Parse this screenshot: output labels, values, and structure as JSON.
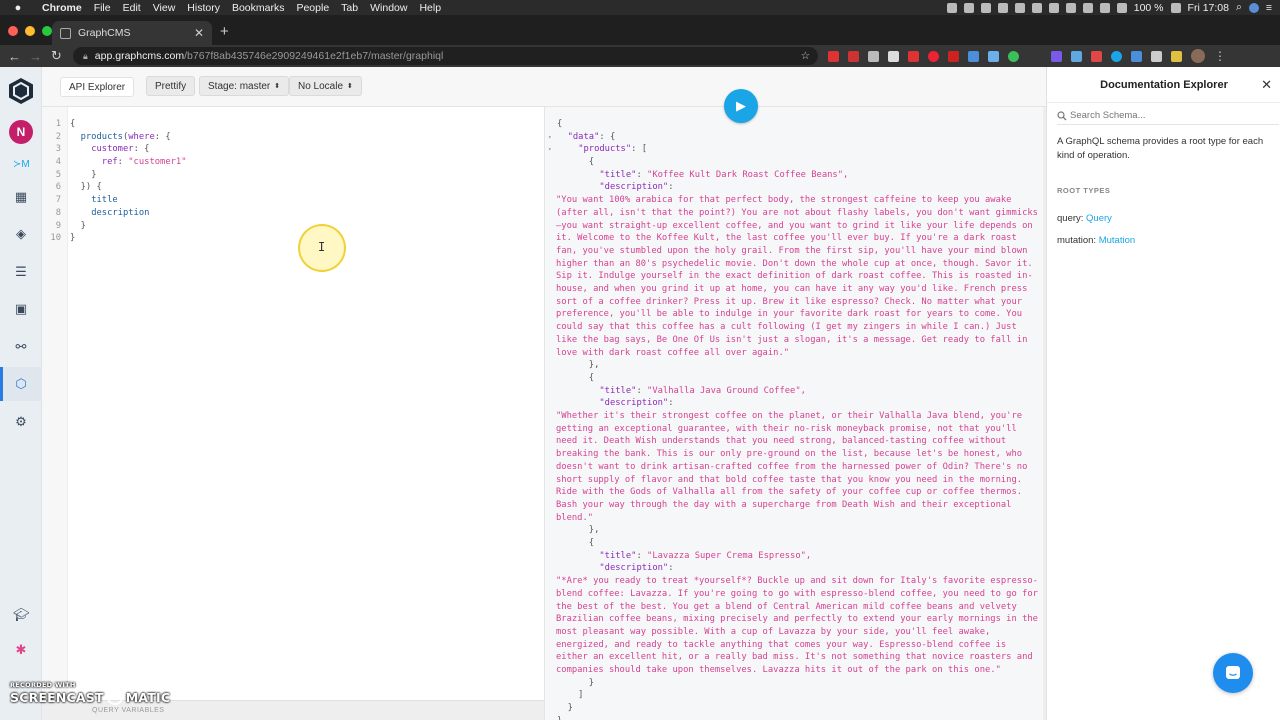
{
  "macos": {
    "app_name": "Chrome",
    "menus": [
      "File",
      "Edit",
      "View",
      "History",
      "Bookmarks",
      "People",
      "Tab",
      "Window",
      "Help"
    ],
    "battery": "100 %",
    "clock": "Fri 17:08"
  },
  "browser": {
    "tab_title": "GraphCMS",
    "url_host": "app.graphcms.com",
    "url_path": "/b767f8ab435746e2909249461e2f1eb7/master/graphiql"
  },
  "app": {
    "avatar_letter": "N"
  },
  "toolbar": {
    "api_explorer": "API Explorer",
    "prettify": "Prettify",
    "stage": "Stage: master",
    "locale": "No Locale"
  },
  "query": {
    "lines": [
      {
        "n": "1",
        "indent": "",
        "tokens": [
          {
            "t": "{",
            "c": "c-punct"
          }
        ]
      },
      {
        "n": "2",
        "indent": "  ",
        "tokens": [
          {
            "t": "products",
            "c": "c-call"
          },
          {
            "t": "(",
            "c": "c-punct"
          },
          {
            "t": "where",
            "c": "c-arg"
          },
          {
            "t": ": {",
            "c": "c-punct"
          }
        ]
      },
      {
        "n": "3",
        "indent": "    ",
        "tokens": [
          {
            "t": "customer",
            "c": "c-arg"
          },
          {
            "t": ": {",
            "c": "c-punct"
          }
        ]
      },
      {
        "n": "4",
        "indent": "      ",
        "tokens": [
          {
            "t": "ref",
            "c": "c-arg"
          },
          {
            "t": ": ",
            "c": "c-punct"
          },
          {
            "t": "\"customer1\"",
            "c": "c-str"
          }
        ]
      },
      {
        "n": "5",
        "indent": "    ",
        "tokens": [
          {
            "t": "}",
            "c": "c-punct"
          }
        ]
      },
      {
        "n": "6",
        "indent": "  ",
        "tokens": [
          {
            "t": "}) {",
            "c": "c-punct"
          }
        ]
      },
      {
        "n": "7",
        "indent": "    ",
        "tokens": [
          {
            "t": "title",
            "c": "c-field"
          }
        ]
      },
      {
        "n": "8",
        "indent": "    ",
        "tokens": [
          {
            "t": "description",
            "c": "c-field"
          }
        ]
      },
      {
        "n": "9",
        "indent": "  ",
        "tokens": [
          {
            "t": "}",
            "c": "c-punct"
          }
        ]
      },
      {
        "n": "10",
        "indent": "",
        "tokens": [
          {
            "t": "}",
            "c": "c-punct"
          }
        ]
      }
    ]
  },
  "variables_label": "QUERY VARIABLES",
  "result": {
    "data_key": "\"data\"",
    "products_key": "\"products\"",
    "title_key": "\"title\"",
    "description_key": "\"description\"",
    "products": [
      {
        "title": "\"Koffee Kult Dark Roast Coffee Beans\",",
        "description": "\"You want 100% arabica for that perfect body, the strongest caffeine to keep you awake (after all, isn't that the point?) You are not about flashy labels, you don't want gimmicks—you want straight-up excellent coffee, and you want to grind it like your life depends on it. Welcome to the Koffee Kult, the last coffee you'll ever buy. If you're a dark roast fan, you've stumbled upon the holy grail. From the first sip, you'll have your mind blown higher than an 80's psychedelic movie. Don't down the whole cup at once, though. Savor it. Sip it. Indulge yourself in the exact definition of dark roast coffee. This is roasted in-house, and when you grind it up at home, you can have it any way you'd like. French press sort of a coffee drinker? Press it up. Brew it like espresso? Check. No matter what your preference, you'll be able to indulge in your favorite dark roast for years to come. You could say that this coffee has a cult following (I get my zingers in while I can.) Just like the bag says, Be One Of Us isn't just a slogan, it's a message. Get ready to fall in love with dark roast coffee all over again.\""
      },
      {
        "title": "\"Valhalla Java Ground Coffee\",",
        "description": "\"Whether it's their strongest coffee on the planet, or their Valhalla Java blend, you're getting an exceptional guarantee, with their no-risk moneyback promise, not that you'll need it. Death Wish understands that you need strong, balanced-tasting coffee without breaking the bank. This is our only pre-ground on the list, because let's be honest, who doesn't want to drink artisan-crafted coffee from the harnessed power of Odin? There's no short supply of flavor and that bold coffee taste that you know you need in the morning. Ride with the Gods of Valhalla all from the safety of your coffee cup or coffee thermos. Bash your way through the day with a supercharge from Death Wish and their exceptional blend.\""
      },
      {
        "title": "\"Lavazza Super Crema Espresso\",",
        "description": "\"*Are* you ready to treat *yourself*? Buckle up and sit down for Italy's favorite espresso-blend coffee: Lavazza. If you're going to go with espresso-blend coffee, you need to go for the best of the best. You get a blend of Central American mild coffee beans and velvety Brazilian coffee beans, mixing precisely and perfectly to extend your early mornings in the most pleasant way possible. With a cup of Lavazza by your side, you'll feel awake, energized, and ready to tackle anything that comes your way. Espresso-blend coffee is either an excellent hit, or a really bad miss. It's not something that novice roasters and companies should take upon themselves. Lavazza hits it out of the park on this one.\""
      }
    ]
  },
  "docs": {
    "title": "Documentation Explorer",
    "search_placeholder": "Search Schema...",
    "description": "A GraphQL schema provides a root type for each kind of operation.",
    "root_types_label": "ROOT TYPES",
    "query_label": "query:",
    "query_type": "Query",
    "mutation_label": "mutation:",
    "mutation_type": "Mutation"
  },
  "watermark": {
    "line1": "RECORDED WITH",
    "line2a": "SCREENCAST",
    "line2b": "MATIC"
  },
  "colors": {
    "accent": "#1aa5e6",
    "avatar": "#c4206a",
    "string": "#d64292",
    "keyword": "#8b2bb9"
  }
}
